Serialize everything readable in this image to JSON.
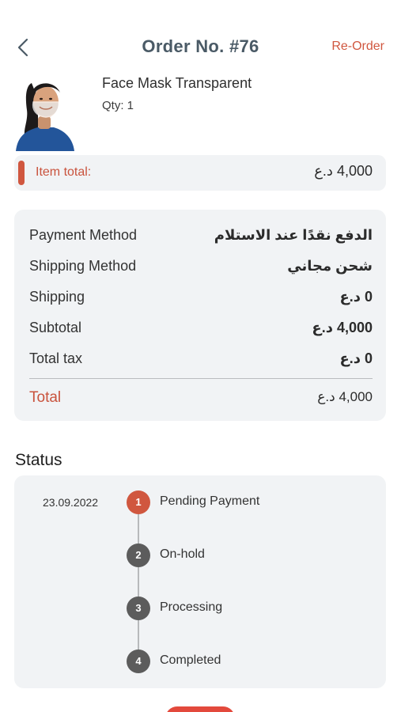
{
  "header": {
    "title": "Order No. #76",
    "reorder_label": "Re-Order"
  },
  "product": {
    "name": "Face Mask Transparent",
    "qty": "Qty: 1"
  },
  "item_total": {
    "label": "Item total:",
    "value": "4,000 د.ع"
  },
  "summary": {
    "rows": [
      {
        "label": "Payment Method",
        "value": "الدفع نقدًا عند الاستلام"
      },
      {
        "label": "Shipping Method",
        "value": "شحن مجاني"
      },
      {
        "label": "Shipping",
        "value": "0 د.ع"
      },
      {
        "label": "Subtotal",
        "value": "4,000 د.ع"
      },
      {
        "label": "Total tax",
        "value": "0 د.ع"
      }
    ],
    "total": {
      "label": "Total",
      "value": "4,000 د.ع"
    }
  },
  "status": {
    "title": "Status",
    "date": "23.09.2022",
    "steps": [
      {
        "num": "1",
        "label": "Pending Payment",
        "active": true
      },
      {
        "num": "2",
        "label": "On-hold",
        "active": false
      },
      {
        "num": "3",
        "label": "Processing",
        "active": false
      },
      {
        "num": "4",
        "label": "Completed",
        "active": false
      }
    ]
  },
  "colors": {
    "accent": "#d0573f",
    "card_bg": "#f1f3f5",
    "title": "#4a5a66",
    "step_inactive": "#5c5c5c"
  }
}
